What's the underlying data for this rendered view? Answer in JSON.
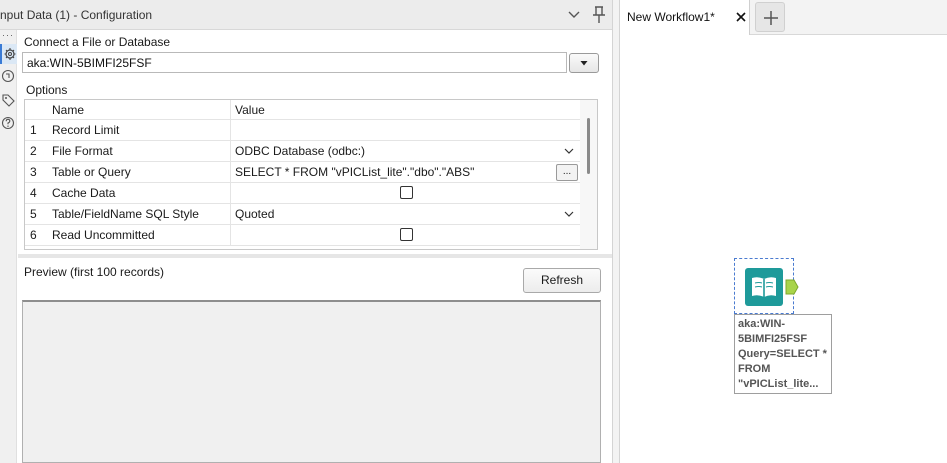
{
  "config_panel": {
    "title": "nput Data (1) - Configuration",
    "connect_label": "Connect a File or Database",
    "connection_value": "aka:WIN-5BIMFI25FSF",
    "options_label": "Options",
    "grid": {
      "headers": {
        "name": "Name",
        "value": "Value"
      },
      "rows": [
        {
          "num": "1",
          "name": "Record Limit",
          "value": "",
          "kind": "text"
        },
        {
          "num": "2",
          "name": "File Format",
          "value": "ODBC Database (odbc:)",
          "kind": "dropdown"
        },
        {
          "num": "3",
          "name": "Table or Query",
          "value": "SELECT * FROM \"vPICList_lite\".\"dbo\".\"ABS\"",
          "kind": "ellipsis",
          "ellipsis_label": "..."
        },
        {
          "num": "4",
          "name": "Cache Data",
          "value": "",
          "kind": "checkbox",
          "checked": false
        },
        {
          "num": "5",
          "name": "Table/FieldName SQL Style",
          "value": "Quoted",
          "kind": "dropdown"
        },
        {
          "num": "6",
          "name": "Read Uncommitted",
          "value": "",
          "kind": "checkbox",
          "checked": false
        }
      ]
    },
    "preview_label": "Preview (first 100 records)",
    "refresh_label": "Refresh",
    "side_tabs": [
      "gear-icon",
      "workflow-icon",
      "tag-icon",
      "help-icon"
    ]
  },
  "workflow": {
    "tab_title": "New Workflow1*",
    "tool_annotation_lines": [
      "aka:WIN-",
      "5BIMFI25FSF",
      "Query=SELECT *",
      "FROM",
      "\"vPICList_lite..."
    ]
  },
  "colors": {
    "tool_teal": "#1e9a9a",
    "anchor_green": "#a8d44a",
    "selection_blue": "#4a7bd0"
  }
}
